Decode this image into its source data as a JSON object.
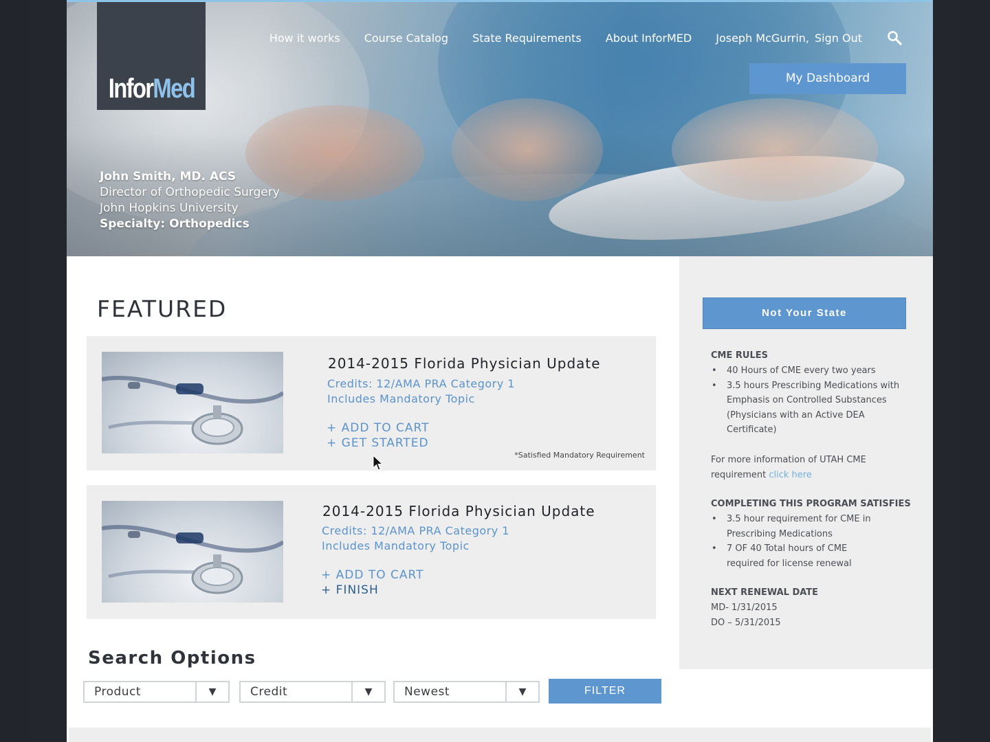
{
  "brand": {
    "logo_part1": "Infor",
    "logo_part2": "Med"
  },
  "nav": {
    "items": [
      "How it works",
      "Course Catalog",
      "State Requirements",
      "About InforMED"
    ],
    "user_name": "Joseph McGurrin,",
    "sign_out": "Sign Out",
    "search_icon": "search-icon"
  },
  "dashboard_button": "My Dashboard",
  "profile": {
    "name": "John Smith, MD. ACS",
    "title": "Director of Orthopedic Surgery",
    "institution": "John Hopkins University",
    "specialty": "Specialty: Orthopedics"
  },
  "featured": {
    "heading": "FEATURED",
    "cards": [
      {
        "title": "2014-2015 Florida  Physician Update",
        "credits": "Credits: 12/AMA PRA Category 1",
        "mandatory": "Includes Mandatory Topic",
        "action1": "+ ADD TO CART",
        "action2": "+ GET STARTED",
        "note": "*Satisfied Mandatory Requirement"
      },
      {
        "title": "2014-2015 Florida  Physician Update",
        "credits": "Credits: 12/AMA PRA Category 1",
        "mandatory": "Includes Mandatory Topic",
        "action1": "+ ADD TO CART",
        "action2": "+ FINISH"
      }
    ]
  },
  "search_options": {
    "heading": "Search Options",
    "selects": [
      "Product",
      "Credit",
      "Newest"
    ],
    "filter_button": "FILTER"
  },
  "sidebar": {
    "state_button": "Not Your State",
    "cme_rules_heading": "CME RULES",
    "cme_rules": [
      "40 Hours of CME every two years",
      "3.5 hours Prescribing Medications with Emphasis on Controlled Substances (Physicians with an Active DEA Certificate)"
    ],
    "more_info_text": "For more information of UTAH CME requirement",
    "click_here": "click here",
    "satisfies_heading": "COMPLETING THIS PROGRAM SATISFIES",
    "satisfies": [
      "3.5 hour requirement for CME in Prescribing Medications",
      "7 OF 40 Total hours of CME required for license renewal"
    ],
    "renewal_heading": "NEXT RENEWAL DATE",
    "renewal_md": "MD- 1/31/2015",
    "renewal_do": "DO – 5/31/2015"
  },
  "colors": {
    "accent": "#5e96cf",
    "link": "#5b93cc",
    "logo_box": "#3c424b",
    "panel": "#eeeeee"
  }
}
